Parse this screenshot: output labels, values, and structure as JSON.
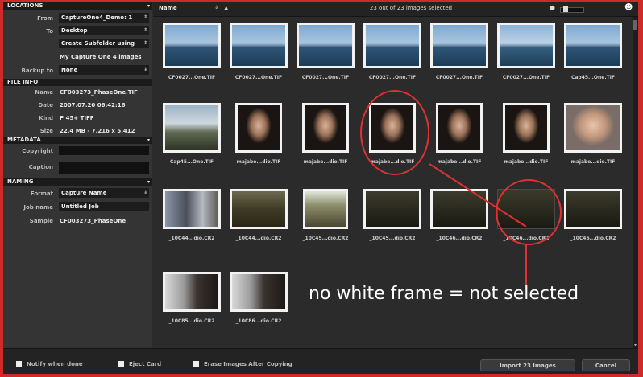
{
  "left_panel": {
    "locations": {
      "title": "LOCATIONS",
      "from_label": "From",
      "from_value": "CaptureOne4_Demo: 1",
      "to_label": "To",
      "to_value": "Desktop",
      "subfolder_value": "Create Subfolder using",
      "path_text": "My Capture One 4 images",
      "backup_label": "Backup to",
      "backup_value": "None"
    },
    "file_info": {
      "title": "FILE INFO",
      "name_label": "Name",
      "name_value": "CF003273_PhaseOne.TIF",
      "date_label": "Date",
      "date_value": "2007.07.20 06:42:16",
      "kind_label": "Kind",
      "kind_value": "P 45+ TIFF",
      "size_label": "Size",
      "size_value": "22.4 MB - 7.216 x 5.412"
    },
    "metadata": {
      "title": "METADATA",
      "copyright_label": "Copyright",
      "copyright_value": "",
      "caption_label": "Caption",
      "caption_value": ""
    },
    "naming": {
      "title": "NAMING",
      "format_label": "Format",
      "format_value": "Capture Name",
      "job_label": "Job name",
      "job_value": "Untitled Job",
      "sample_label": "Sample",
      "sample_value": "CF003273_PhaseOne"
    }
  },
  "topbar": {
    "sort_value": "Name",
    "sort_direction": "▲",
    "count_text": "23 out of 23 images selected",
    "person_icon": "person-icon"
  },
  "thumbnails": [
    {
      "caption": "CF0027...One.TIF",
      "selected": true,
      "scene": "sea"
    },
    {
      "caption": "CF0027...One.TIF",
      "selected": true,
      "scene": "sea"
    },
    {
      "caption": "CF0027...One.TIF",
      "selected": true,
      "scene": "sea"
    },
    {
      "caption": "CF0027...One.TIF",
      "selected": true,
      "scene": "sea"
    },
    {
      "caption": "CF0027...One.TIF",
      "selected": true,
      "scene": "sea"
    },
    {
      "caption": "CF0027...One.TIF",
      "selected": true,
      "scene": "pier"
    },
    {
      "caption": "Cap45...One.TIF",
      "selected": true,
      "scene": "sea"
    },
    {
      "caption": "Cap45...One.TIF",
      "selected": true,
      "scene": "land"
    },
    {
      "caption": "majabe...dio.TIF",
      "selected": true,
      "scene": "portrait"
    },
    {
      "caption": "majabe...dio.TIF",
      "selected": true,
      "scene": "portrait"
    },
    {
      "caption": "majabe...dio.TIF",
      "selected": true,
      "scene": "portrait"
    },
    {
      "caption": "majabe...dio.TIF",
      "selected": true,
      "scene": "portrait"
    },
    {
      "caption": "majabe...dio.TIF",
      "selected": true,
      "scene": "portrait"
    },
    {
      "caption": "majabe...dio.TIF",
      "selected": true,
      "scene": "portrait-light"
    },
    {
      "caption": "_10C44...dio.CR2",
      "selected": true,
      "scene": "outdoor"
    },
    {
      "caption": "_10C44...dio.CR2",
      "selected": true,
      "scene": "forest"
    },
    {
      "caption": "_10C45...dio.CR2",
      "selected": true,
      "scene": "forest-tall"
    },
    {
      "caption": "_10C45...dio.CR2",
      "selected": true,
      "scene": "dark-forest"
    },
    {
      "caption": "_10C46...dio.CR2",
      "selected": true,
      "scene": "dark-forest"
    },
    {
      "caption": "_10C46...dio.CR2",
      "selected": false,
      "scene": "dark-forest"
    },
    {
      "caption": "_10C46...dio.CR2",
      "selected": true,
      "scene": "dark-forest"
    },
    {
      "caption": "_10C85...dio.CR2",
      "selected": true,
      "scene": "studio"
    },
    {
      "caption": "_10C86...dio.CR2",
      "selected": true,
      "scene": "studio"
    }
  ],
  "bottom": {
    "notify_label": "Notify when done",
    "eject_label": "Eject Card",
    "erase_label": "Erase Images After Copying",
    "import_button": "Import 23 Images",
    "cancel_button": "Cancel"
  },
  "annotation": {
    "text": "no white frame = not selected",
    "color": "#e03030"
  }
}
